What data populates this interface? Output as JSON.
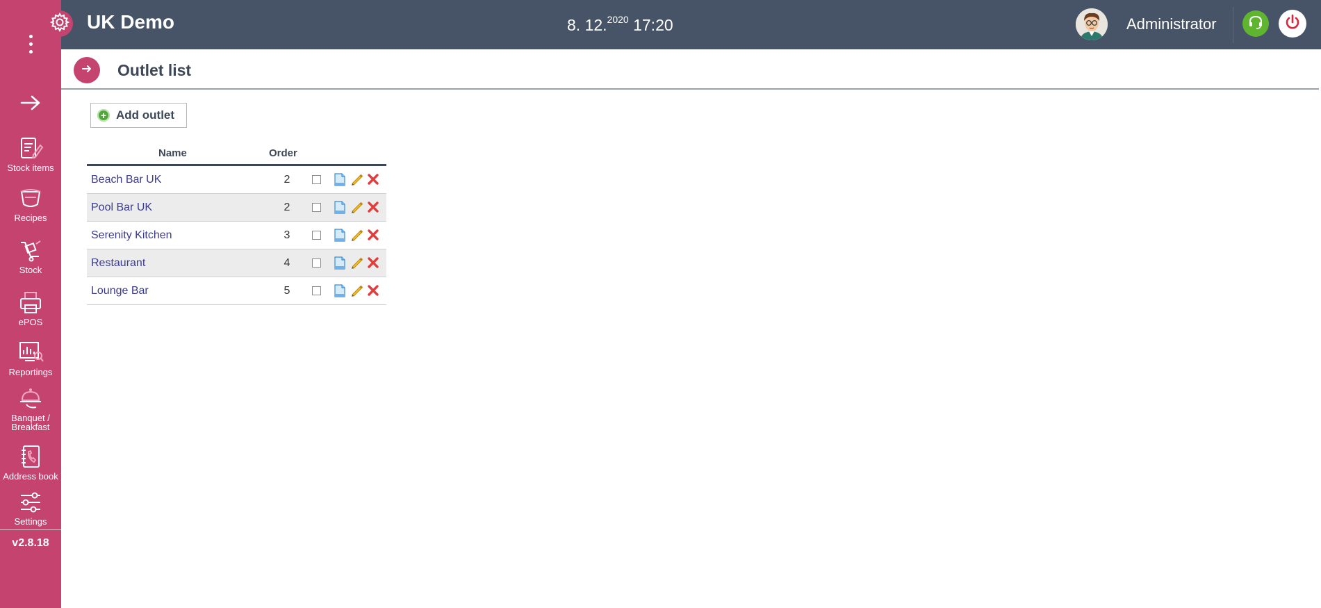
{
  "app": {
    "title": "UK Demo",
    "date_main": "8. 12.",
    "date_year": "2020",
    "time": "17:20",
    "user": "Administrator",
    "version": "v2.8.18",
    "accent_color": "#c4446f",
    "header_color": "#475366"
  },
  "sidebar": {
    "items": [
      {
        "label": "Stock items",
        "icon": "stock-items-icon"
      },
      {
        "label": "Recipes",
        "icon": "recipes-icon"
      },
      {
        "label": "Stock",
        "icon": "stock-cart-icon"
      },
      {
        "label": "ePOS",
        "icon": "printer-icon"
      },
      {
        "label": "Reportings",
        "icon": "reporting-chart-icon"
      },
      {
        "label_line1": "Banquet /",
        "label_line2": "Breakfast",
        "icon": "cloche-icon"
      },
      {
        "label": "Address book",
        "icon": "address-book-icon"
      },
      {
        "label": "Settings",
        "icon": "sliders-icon"
      }
    ]
  },
  "page": {
    "title": "Outlet list",
    "add_label": "Add outlet"
  },
  "table": {
    "columns": {
      "name": "Name",
      "order": "Order"
    },
    "rows": [
      {
        "name": "Beach Bar UK",
        "order": "2"
      },
      {
        "name": "Pool Bar UK",
        "order": "2"
      },
      {
        "name": "Serenity Kitchen",
        "order": "3"
      },
      {
        "name": "Restaurant",
        "order": "4"
      },
      {
        "name": "Lounge Bar",
        "order": "5"
      }
    ]
  }
}
